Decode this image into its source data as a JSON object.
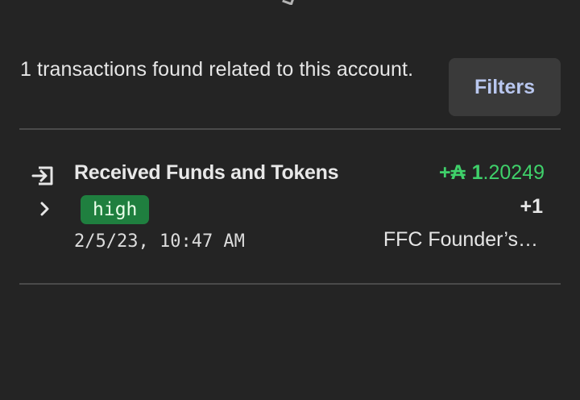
{
  "header": {
    "summary_text": "1 transactions found related to this account.",
    "filters_label": "Filters"
  },
  "transactions": [
    {
      "icon": "receive-icon",
      "title": "Received Funds and Tokens",
      "risk": "high",
      "date": "2/5/23, 10:47 AM",
      "amount_sign": "+",
      "amount_symbol": "₳",
      "amount_int": "1",
      "amount_frac": ".20249",
      "token_count": "+1",
      "token_name": "FFC Founder’s…"
    }
  ],
  "colors": {
    "background": "#242424",
    "button_bg": "#3a3a3a",
    "button_text": "#b9c7ef",
    "positive_amount": "#3fd06a",
    "badge_bg": "#1f7f3f",
    "divider": "#4a4a4a"
  }
}
